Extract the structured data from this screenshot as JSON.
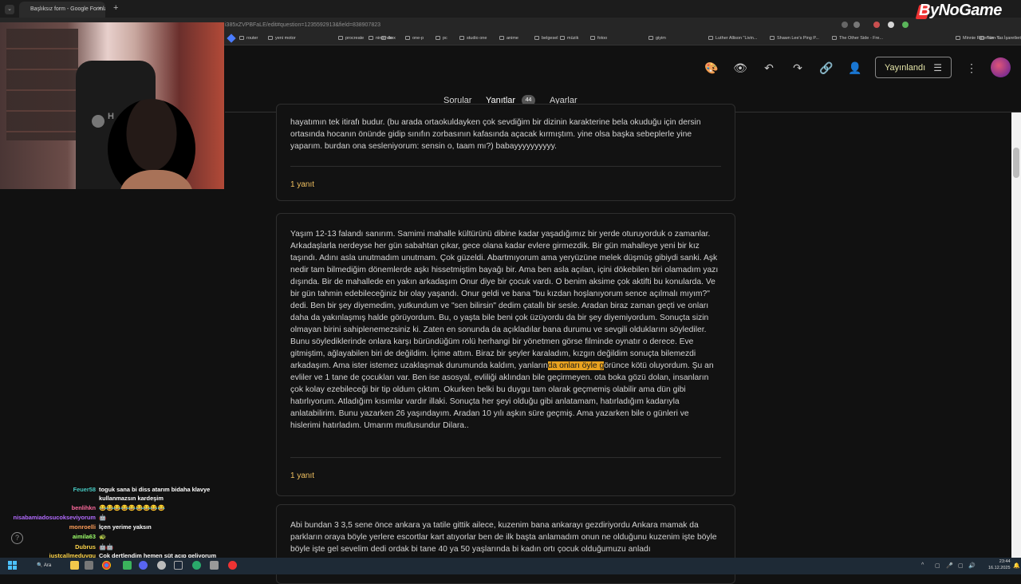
{
  "browser": {
    "tab_title": "Başlıksız form - Google Formlar",
    "tab_close": "✕",
    "new_tab": "+",
    "url": "i385xZVPBFaLE/edit#question=1235592913&field=838907823",
    "bookmarks": [
      "router",
      "yeni motor",
      "procreate",
      "nintendo",
      "box",
      "one-p",
      "pc",
      "studio one",
      "anime",
      "belgesel",
      "müzik",
      "fotoo",
      "giyim",
      "Luther Allison \"Livin...",
      "Shawn Lee's Ping P...",
      "The Other Side - Fre...",
      "Minnie Riperton - L...",
      "Tüm Yer İşaretleri"
    ],
    "brand": "ByNoGame"
  },
  "forms": {
    "publish_label": "Yayınlandı",
    "tabs": {
      "questions": "Sorular",
      "responses": "Yanıtlar",
      "responses_count": "44",
      "settings": "Ayarlar"
    }
  },
  "responses": [
    {
      "text": "hayatımın tek itirafı budur. (bu arada ortaokuldayken çok sevdiğim bir dizinin karakterine bela okuduğu için dersin ortasında hocanın önünde gidip sınıfın zorbasının kafasında açacak kırmıştım. yine olsa başka sebeplerle yine yaparım. burdan ona sesleniyorum: sensin o, taam mı?) babayyyyyyyyyy.",
      "reply": "1 yanıt"
    },
    {
      "text_before": "Yaşım 12-13 falandı sanırım. Samimi mahalle kültürünü dibine kadar yaşadığımız bir yerde oturuyorduk o zamanlar. Arkadaşlarla nerdeyse her gün sabahtan çıkar, gece olana kadar evlere girmezdik. Bir gün mahalleye yeni bir kız taşındı. Adını asla unutmadım unutmam. Çok güzeldi. Abartmıyorum ama yeryüzüne melek düşmüş gibiydi sanki. Aşk nedir tam bilmediğim dönemlerde aşkı hissetmiştim bayağı bir. Ama ben asla açılan, içini dökebilen biri olamadım yazı dışında. Bir de mahallede en yakın arkadaşım Onur diye bir çocuk vardı. O benim aksime çok aktifti bu konularda. Ve bir gün tahmin edebileceğiniz bir olay yaşandı. Onur geldi ve bana \"bu kızdan hoşlanıyorum sence açılmalı mıyım?\" dedi. Ben bir şey diyemedim, yutkundum ve \"sen bilirsin\" dedim çatallı bir sesle. Aradan biraz zaman geçti ve onları daha da yakınlaşmış halde görüyordum. Bu, o yaşta bile beni çok üzüyordu da bir şey diyemiyordum. Sonuçta sizin olmayan birini sahiplenemezsiniz ki. Zaten en sonunda da açıkladılar bana durumu ve sevgili olduklarını söylediler. Bunu söylediklerinde onlara karşı büründüğüm rolü herhangi bir yönetmen görse filminde oynatır o derece. Eve gitmiştim, ağlayabilen biri de değildim. İçime attım. Biraz bir şeyler karaladım, kızgın değildim sonuçta bilemezdi arkadaşım. Ama ister istemez uzaklaşmak durumunda kaldım, yanların",
      "text_highlight": "da onları öyle g",
      "text_after": "örünce kötü oluyordum. Şu an evliler ve 1 tane de çocukları var. Ben ise asosyal, evliliği aklından bile geçirmeyen. ota boka gözü dolan, insanların çok kolay ezebileceği bir tip oldum çıktım. Okurken belki bu duygu tam olarak geçmemiş olabilir ama dün gibi hatırlıyorum. Atladığım kısımlar vardır illaki. Sonuçta her şeyi olduğu gibi anlatamam, hatırladığım kadarıyla anlatabilirim. Bunu yazarken 26 yaşındayım. Aradan 10 yılı aşkın süre geçmiş. Ama yazarken bile o günleri ve hislerimi hatırladım. Umarım mutlusundur Dilara..",
      "reply": "1 yanıt"
    },
    {
      "text": "Abi bundan 3 3,5 sene önce ankara ya tatile gittik ailece, kuzenim bana ankarayı gezdiriyordu Ankara mamak da parkların oraya böyle yerlere escortlar kart atıyorlar ben de ilk başta anlamadım onun ne olduğunu kuzenim işte böyle böyle işte gel sevelim dedi ordak bi tane 40 ya 50 yaşlarında bi kadın ortı çocuk olduğumuzu anladı"
    }
  ],
  "webcam": {
    "chair_text": "H"
  },
  "chat": [
    {
      "user": "Feuer58",
      "color": "#46c9c1",
      "msg": "toguk sana bi diss atarım bidaha klavye"
    },
    {
      "user": "",
      "color": "#ffffff",
      "msg": "kullanmazsın kardeşim"
    },
    {
      "user": "benlihkn",
      "color": "#ff6b9e",
      "msg": "😂😂😂😂😂😂😂😂😂"
    },
    {
      "user": "nisabamiadosucokseviyorum",
      "color": "#b36bff",
      "msg": "🤖"
    },
    {
      "user": "monroelli",
      "color": "#ff9f5a",
      "msg": "İçen yerime yaksın"
    },
    {
      "user": "aimila63",
      "color": "#9dff6b",
      "msg": "🐢"
    },
    {
      "user": "Dubrus",
      "color": "#ffd54a",
      "msg": "🤖🤖"
    },
    {
      "user": "justcallmeduygu",
      "color": "#ffd54a",
      "msg": "Çok dertlendim hemen süt açıp geliyorum"
    }
  ],
  "taskbar": {
    "search": "Ara",
    "time": "23:44",
    "date": "16.12.2025"
  }
}
